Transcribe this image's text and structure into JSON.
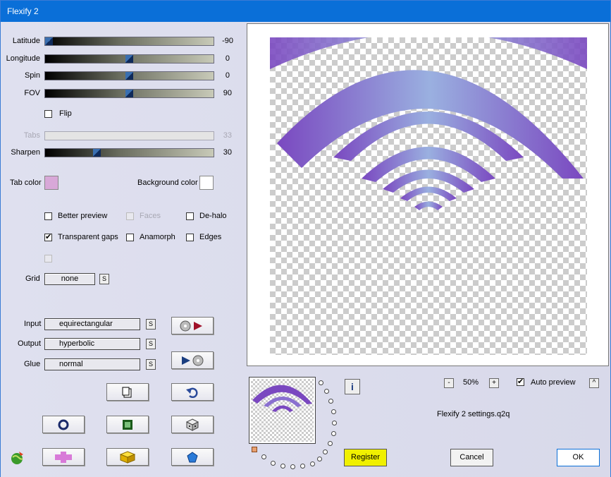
{
  "window": {
    "title": "Flexify 2"
  },
  "sliders": [
    {
      "label": "Latitude",
      "value": "-90",
      "fraction": 0.0
    },
    {
      "label": "Longitude",
      "value": "0",
      "fraction": 0.5
    },
    {
      "label": "Spin",
      "value": "0",
      "fraction": 0.5
    },
    {
      "label": "FOV",
      "value": "90",
      "fraction": 0.5
    },
    {
      "label": "Tabs",
      "value": "33",
      "fraction": 0.33,
      "disabled": true
    },
    {
      "label": "Sharpen",
      "value": "30",
      "fraction": 0.3
    }
  ],
  "flip": {
    "label": "Flip",
    "checked": false
  },
  "colors": {
    "tab_label": "Tab color",
    "tab_color": "#d8a8d8",
    "bg_label": "Background color",
    "bg_color": "#ffffff",
    "accent": "#0a6fd8",
    "register_bg": "#f0f000",
    "shape": "#8a5ac8"
  },
  "options": {
    "better_preview": {
      "label": "Better preview",
      "checked": false
    },
    "faces": {
      "label": "Faces",
      "checked": false,
      "disabled": true
    },
    "dehalo": {
      "label": "De-halo",
      "checked": false
    },
    "transparent_gaps": {
      "label": "Transparent gaps",
      "checked": true
    },
    "anamorph": {
      "label": "Anamorph",
      "checked": false
    },
    "edges": {
      "label": "Edges",
      "checked": false
    }
  },
  "grid": {
    "label": "Grid",
    "value": "none",
    "s": "S"
  },
  "input": {
    "label": "Input",
    "value": "equirectangular",
    "s": "S"
  },
  "output": {
    "label": "Output",
    "value": "hyperbolic",
    "s": "S"
  },
  "glue": {
    "label": "Glue",
    "value": "normal",
    "s": "S"
  },
  "zoom": {
    "minus": "-",
    "value": "50%",
    "plus": "+"
  },
  "auto_preview": {
    "label": "Auto preview",
    "checked": true,
    "up": "^"
  },
  "settings_file": "Flexify 2 settings.q2q",
  "info_icon": "i",
  "buttons": {
    "register": "Register",
    "cancel": "Cancel",
    "ok": "OK"
  },
  "icons": [
    "copy-icon",
    "undo-icon",
    "ring-icon",
    "frame-icon",
    "dice-icon",
    "cross-icon",
    "cube-icon",
    "pentagon-icon",
    "globe-icon"
  ]
}
